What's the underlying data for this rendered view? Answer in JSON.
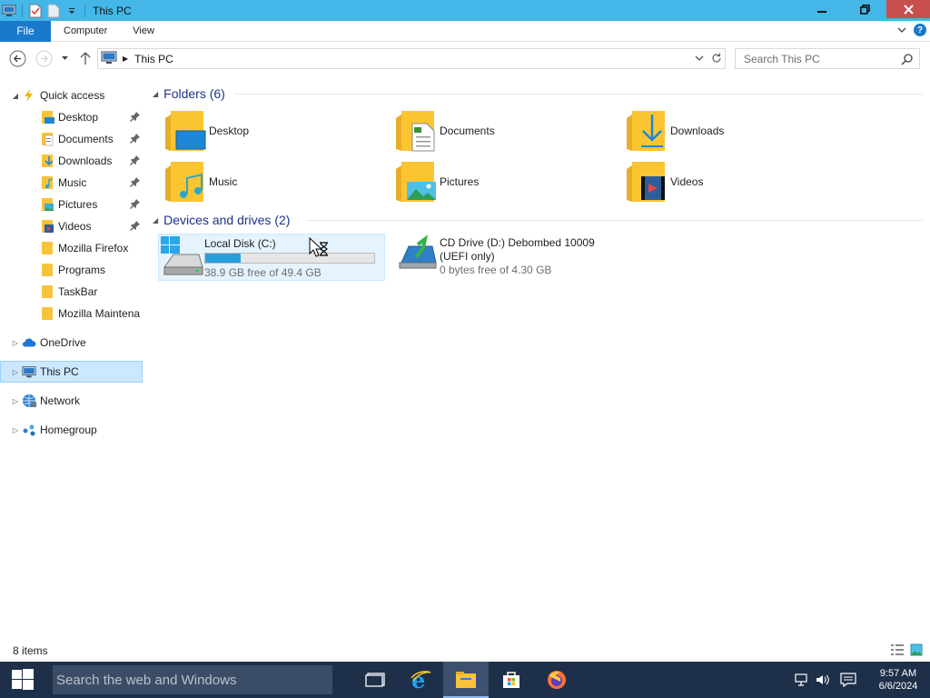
{
  "window": {
    "title": "This PC"
  },
  "ribbon": {
    "file_tab": "File",
    "tabs": [
      "Computer",
      "View"
    ]
  },
  "address": {
    "crumb": "This PC",
    "search_placeholder": "Search This PC"
  },
  "nav": {
    "quick_access": "Quick access",
    "quick_items": [
      "Desktop",
      "Documents",
      "Downloads",
      "Music",
      "Pictures",
      "Videos",
      "Mozilla Firefox",
      "Programs",
      "TaskBar",
      "Mozilla Maintena"
    ],
    "onedrive": "OneDrive",
    "this_pc": "This PC",
    "network": "Network",
    "homegroup": "Homegroup"
  },
  "content": {
    "folders_header": "Folders (6)",
    "folders": [
      "Desktop",
      "Documents",
      "Downloads",
      "Music",
      "Pictures",
      "Videos"
    ],
    "devices_header": "Devices and drives (2)",
    "drives": [
      {
        "name": "Local Disk (C:)",
        "free": "38.9 GB free of 49.4 GB",
        "used_fraction": 0.21
      },
      {
        "name": "CD Drive (D:) Debombed 10009",
        "name2": "(UEFI only)",
        "free": "0 bytes free of 4.30 GB"
      }
    ]
  },
  "status": {
    "items": "8 items"
  },
  "taskbar": {
    "search_placeholder": "Search the web and Windows",
    "time": "9:57 AM",
    "date": "6/6/2024"
  },
  "colors": {
    "titlebar": "#44b7e8",
    "file_tab": "#1979ca",
    "close_button": "#c7504f",
    "taskbar": "#1e2f4a",
    "selection": "#cce8ff",
    "drive_bar": "#26a0da"
  }
}
